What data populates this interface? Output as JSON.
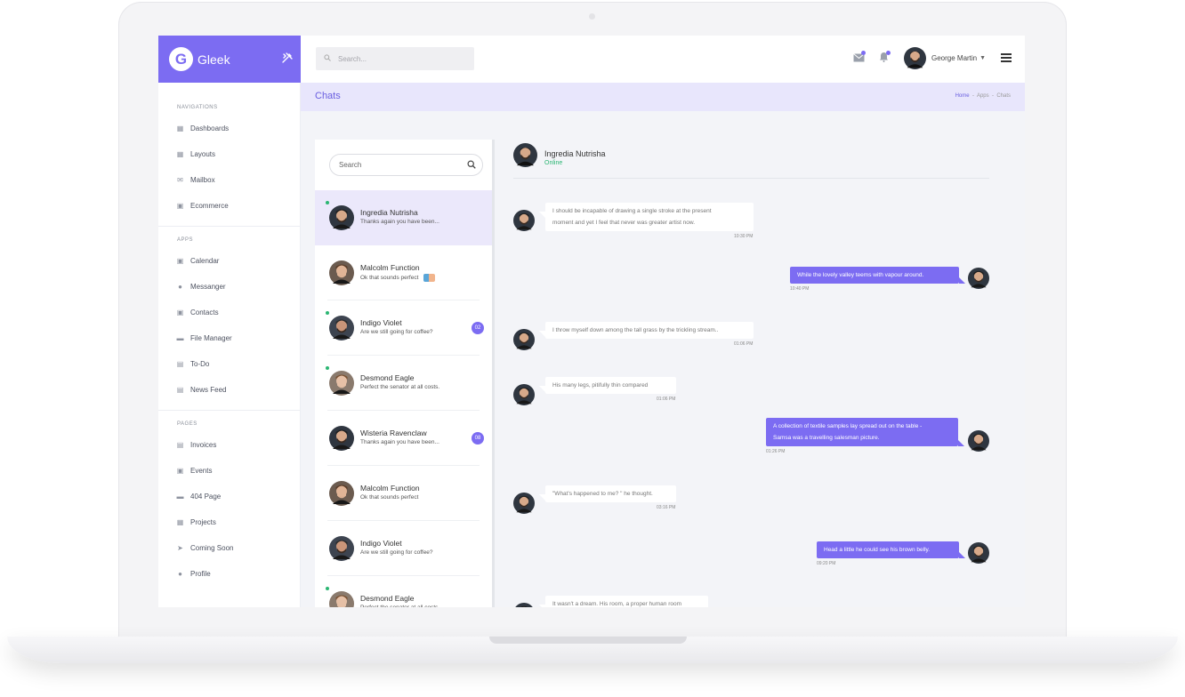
{
  "colors": {
    "accent": "#7c6cf2",
    "online": "#2bb673"
  },
  "brand": {
    "logo_letter": "G",
    "name": "Gleek",
    "tools_icon": "tools-icon"
  },
  "topbar": {
    "search_placeholder": "Search...",
    "user_name": "George Martin"
  },
  "sidebar": {
    "sections": [
      {
        "title": "NAVIGATIONS",
        "items": [
          "Dashboards",
          "Layouts",
          "Mailbox",
          "Ecommerce"
        ]
      },
      {
        "title": "APPS",
        "items": [
          "Calendar",
          "Messanger",
          "Contacts",
          "File Manager",
          "To-Do",
          "News Feed"
        ]
      },
      {
        "title": "PAGES",
        "items": [
          "Invoices",
          "Events",
          "404 Page",
          "Projects",
          "Coming Soon",
          "Profile"
        ]
      }
    ]
  },
  "header": {
    "title": "Chats",
    "breadcrumb": [
      "Home",
      "Apps",
      "Chats"
    ]
  },
  "chat_list": {
    "search_placeholder": "Search",
    "contacts": [
      {
        "name": "Ingredia Nutrisha",
        "message": "Thanks again you have  been...",
        "online": true,
        "active": true,
        "badge": ""
      },
      {
        "name": "Malcolm Function",
        "message": "Ok that sounds perfect",
        "online": false,
        "active": false,
        "badge": ""
      },
      {
        "name": "Indigo Violet",
        "message": "Are we still going for coffee?",
        "online": true,
        "active": false,
        "badge": "02"
      },
      {
        "name": "Desmond Eagle",
        "message": "Perfect the senator at all costs.",
        "online": true,
        "active": false,
        "badge": ""
      },
      {
        "name": "Wisteria Ravenclaw",
        "message": "Thanks again you have  been...",
        "online": false,
        "active": false,
        "badge": "08"
      },
      {
        "name": "Malcolm Function",
        "message": "Ok that sounds perfect",
        "online": false,
        "active": false,
        "badge": ""
      },
      {
        "name": "Indigo Violet",
        "message": "Are we still going for coffee?",
        "online": false,
        "active": false,
        "badge": ""
      },
      {
        "name": "Desmond Eagle",
        "message": "Perfect the senator at all costs.",
        "online": true,
        "active": false,
        "badge": ""
      }
    ]
  },
  "conversation": {
    "name": "Ingredia Nutrisha",
    "status": "Online",
    "messages": [
      {
        "dir": "in",
        "lines": [
          "I should be incapable of drawing a single stroke at the present",
          "moment and yet I feel that never was greater artist now."
        ],
        "time": "10:30 PM"
      },
      {
        "dir": "out",
        "lines": [
          "While the lovely valley teems with vapour around."
        ],
        "time": "10:40 PM"
      },
      {
        "dir": "in",
        "lines": [
          "I throw myself down among the tall grass by the trickling stream.."
        ],
        "time": "01:06 PM"
      },
      {
        "dir": "in",
        "lines": [
          "His many legs, pitifully thin compared"
        ],
        "time": "01:06 PM"
      },
      {
        "dir": "out",
        "lines": [
          "A collection of textile samples lay spread out on the table -",
          "Samsa was a travelling salesman picture."
        ],
        "time": "01:26 PM"
      },
      {
        "dir": "in",
        "lines": [
          "\"What's happened to me? \" he thought."
        ],
        "time": "03:16 PM"
      },
      {
        "dir": "out",
        "lines": [
          "Head a little he could see his brown belly."
        ],
        "time": "09:20 PM"
      },
      {
        "dir": "in",
        "lines": [
          "It wasn't a dream. His room, a proper human room"
        ],
        "time": ""
      }
    ]
  }
}
